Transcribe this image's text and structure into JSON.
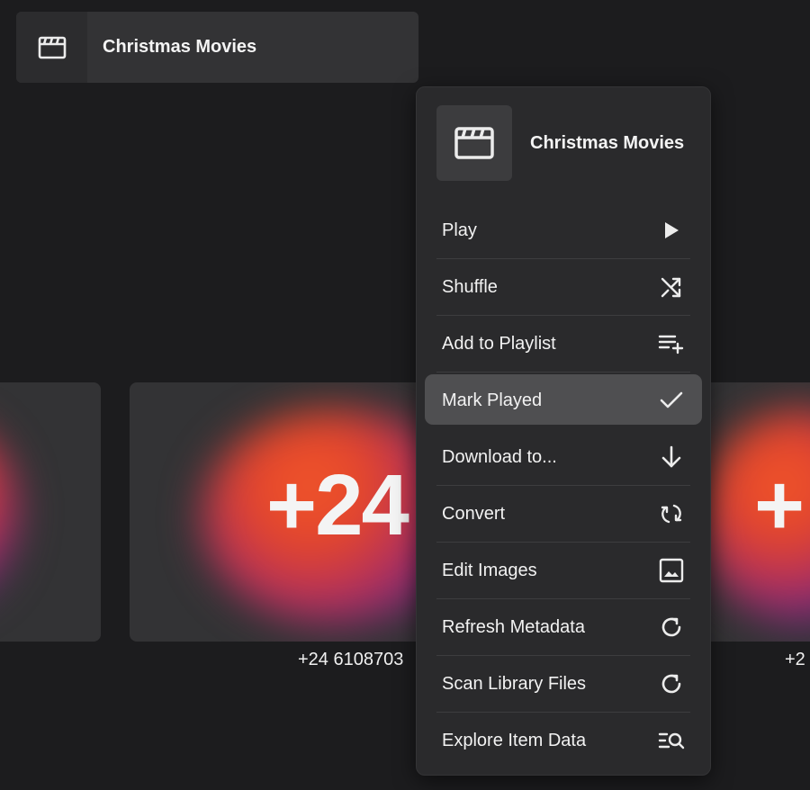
{
  "header": {
    "title": "Christmas Movies",
    "icon": "clapperboard-icon"
  },
  "tiles": {
    "middle_overlay": "+24",
    "right_overlay": "+",
    "middle_caption": "+24 6108703",
    "right_caption": "+2"
  },
  "menu": {
    "title": "Christmas Movies",
    "icon": "clapperboard-icon",
    "items": [
      {
        "label": "Play",
        "icon": "play-icon"
      },
      {
        "label": "Shuffle",
        "icon": "shuffle-icon"
      },
      {
        "label": "Add to Playlist",
        "icon": "playlist-add-icon"
      },
      {
        "label": "Mark Played",
        "icon": "checkmark-icon"
      },
      {
        "label": "Download to...",
        "icon": "download-arrow-icon"
      },
      {
        "label": "Convert",
        "icon": "convert-icon"
      },
      {
        "label": "Edit Images",
        "icon": "image-icon"
      },
      {
        "label": "Refresh Metadata",
        "icon": "refresh-icon"
      },
      {
        "label": "Scan Library Files",
        "icon": "refresh-icon"
      },
      {
        "label": "Explore Item Data",
        "icon": "explore-data-icon"
      }
    ]
  },
  "colors": {
    "background": "#1c1c1e",
    "menu_background": "#2a2a2c",
    "highlight": "#4f4f51",
    "glow_orange": "#f0562a",
    "glow_purple": "#6a2b7a"
  }
}
